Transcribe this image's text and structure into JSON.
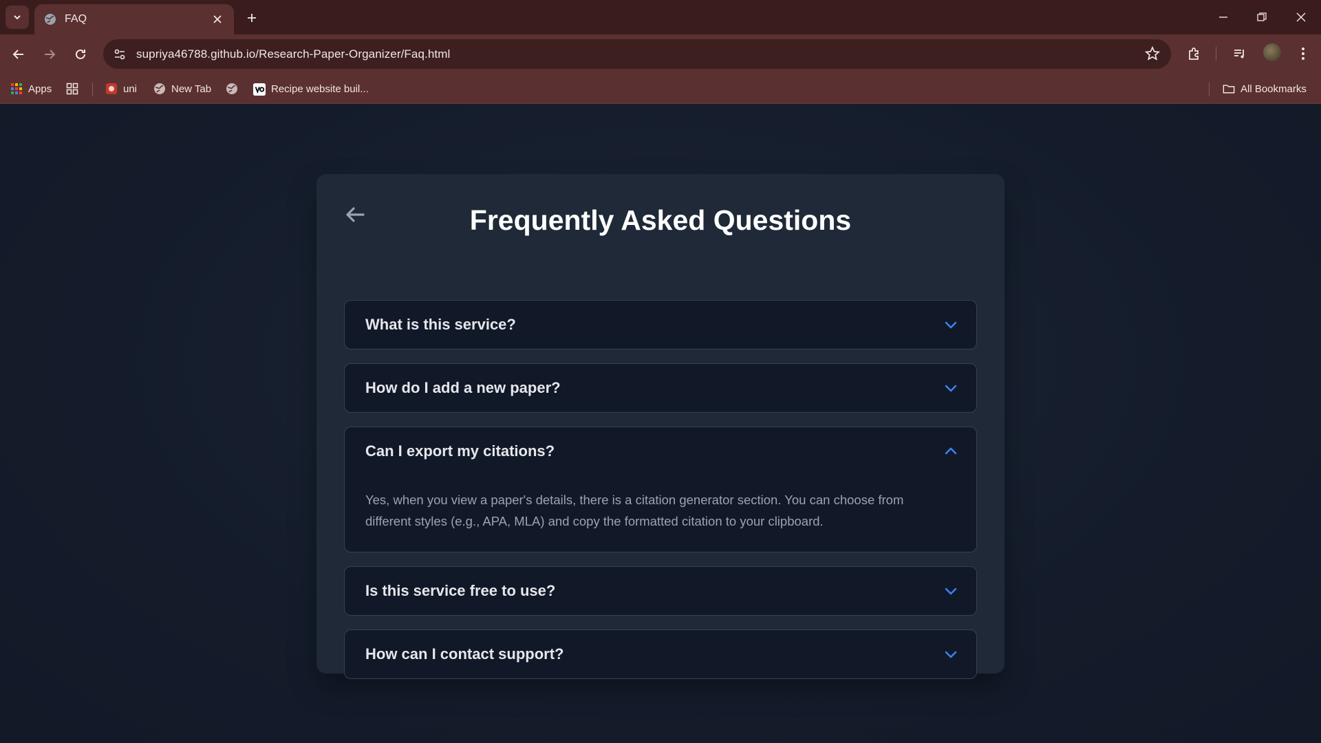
{
  "browser": {
    "tab_title": "FAQ",
    "url": "supriya46788.github.io/Research-Paper-Organizer/Faq.html",
    "bookmarks": [
      {
        "label": "Apps",
        "icon": "apps-grid-icon"
      },
      {
        "label": "",
        "icon": "tab-groups-icon"
      },
      {
        "label": "uni",
        "icon": "uni-favicon"
      },
      {
        "label": "New Tab",
        "icon": "globe-icon"
      },
      {
        "label": "",
        "icon": "globe-icon"
      },
      {
        "label": "Recipe website buil...",
        "icon": "v0-favicon"
      }
    ],
    "all_bookmarks_label": "All Bookmarks"
  },
  "page": {
    "heading": "Frequently Asked Questions",
    "faqs": [
      {
        "question": "What is this service?",
        "expanded": false
      },
      {
        "question": "How do I add a new paper?",
        "expanded": false
      },
      {
        "question": "Can I export my citations?",
        "expanded": true,
        "answer": "Yes, when you view a paper's details, there is a citation generator section. You can choose from different styles (e.g., APA, MLA) and copy the formatted citation to your clipboard."
      },
      {
        "question": "Is this service free to use?",
        "expanded": false
      },
      {
        "question": "How can I contact support?",
        "expanded": false
      }
    ]
  },
  "colors": {
    "accent": "#3b82f6",
    "card_bg": "#1f2937",
    "item_bg": "#111827",
    "chrome_bg": "#5b3030"
  }
}
